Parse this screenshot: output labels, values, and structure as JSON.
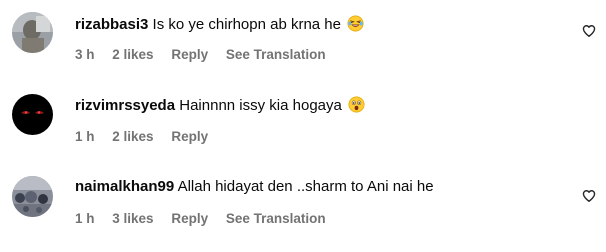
{
  "comments": [
    {
      "username": "rizabbasi3",
      "text": "Is ko ye chirhopn ab krna he",
      "emoji": "laughing-face-emoji",
      "time": "3 h",
      "likes": "2 likes",
      "reply": "Reply",
      "translation": "See Translation"
    },
    {
      "username": "rizvimrssyeda",
      "text": "Hainnnn issy kia hogaya",
      "emoji": "astonished-face-emoji",
      "time": "1 h",
      "likes": "2 likes",
      "reply": "Reply"
    },
    {
      "username": "naimalkhan99",
      "text": "Allah hidayat den ..sharm to Ani nai he",
      "time": "1 h",
      "likes": "3 likes",
      "reply": "Reply",
      "translation": "See Translation"
    }
  ],
  "icons": {
    "like": "heart-outline-icon"
  },
  "colors": {
    "text": "#0a0a0a",
    "meta": "#737373",
    "background": "#ffffff"
  }
}
